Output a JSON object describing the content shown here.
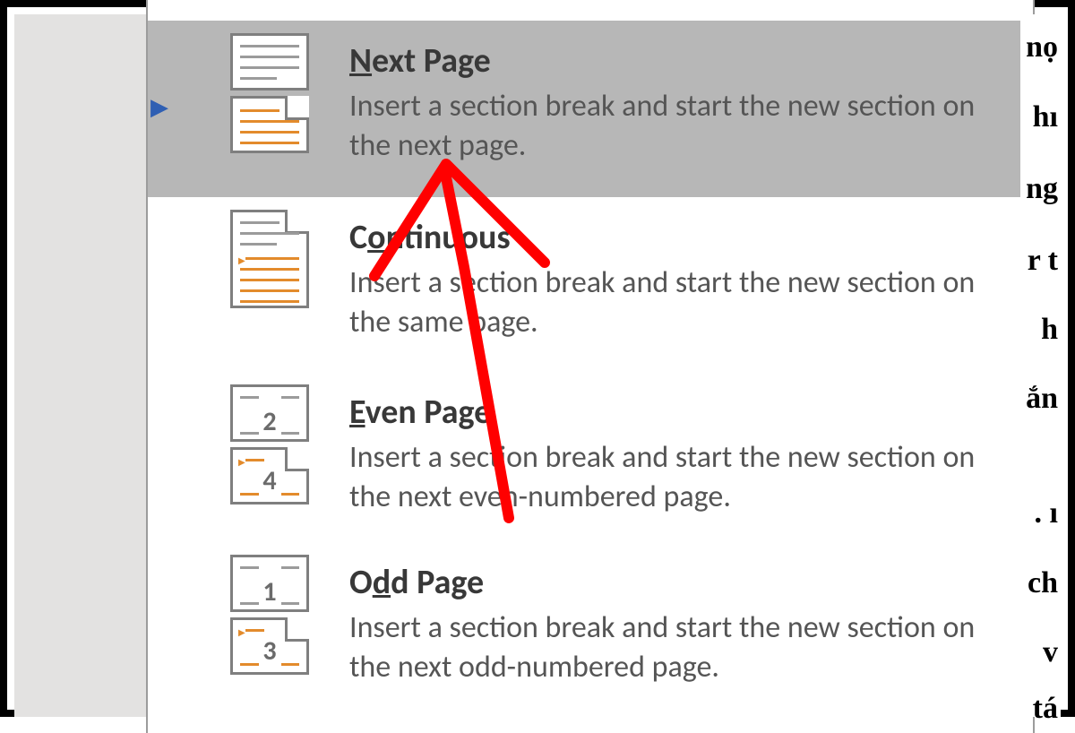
{
  "menu": {
    "items": [
      {
        "title_pre": "",
        "title_u": "N",
        "title_post": "ext Page",
        "desc": "Insert a section break and start the new section on the next page."
      },
      {
        "title_pre": "C",
        "title_u": "o",
        "title_post": "ntinuous",
        "desc": "Insert a section break and start the new section on the same page."
      },
      {
        "title_pre": "",
        "title_u": "E",
        "title_post": "ven Page",
        "desc": "Insert a section break and start the new section on the next even-numbered page."
      },
      {
        "title_pre": "O",
        "title_u": "d",
        "title_post": "d Page",
        "desc": "Insert a section break and start the new section on the next odd-numbered page."
      }
    ]
  },
  "right_text": [
    "nọ",
    "hı",
    "ng",
    "r t",
    "h",
    "ắn",
    ". ı",
    "ch",
    "v",
    "tá"
  ],
  "icon_nums": {
    "even_a": "2",
    "even_b": "4",
    "odd_a": "1",
    "odd_b": "3"
  }
}
